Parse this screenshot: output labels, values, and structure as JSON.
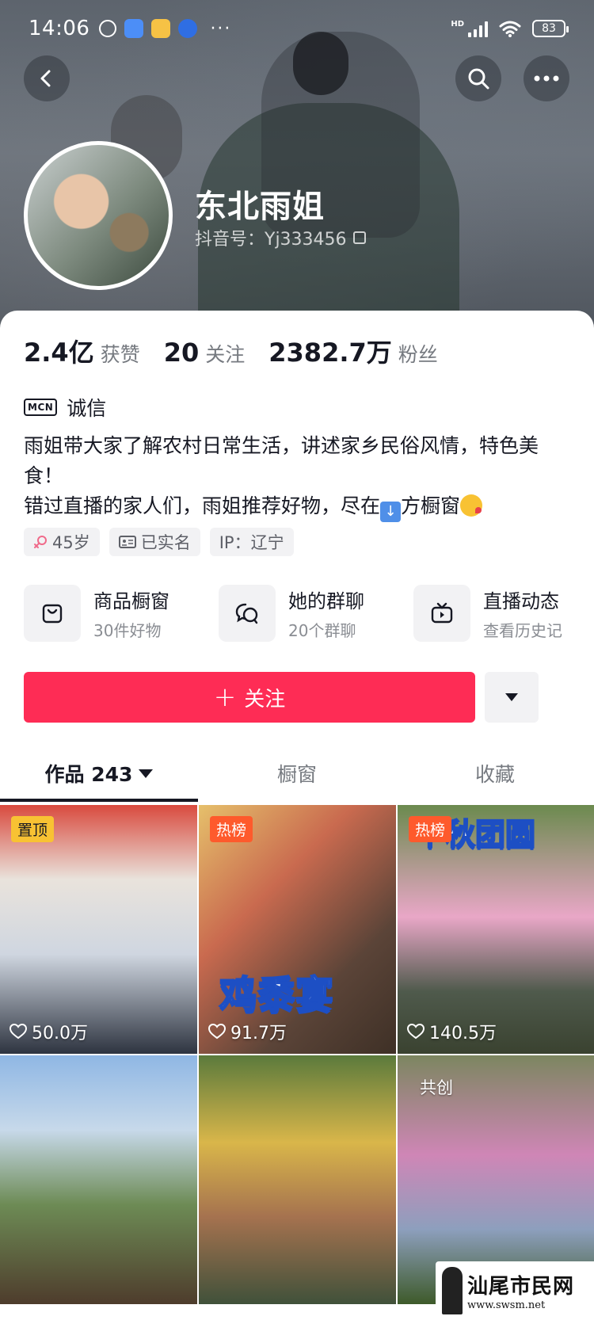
{
  "status_bar": {
    "time": "14:06",
    "network": "HD",
    "battery": "83",
    "icons": [
      "alarm-icon",
      "app-icon",
      "mail-icon",
      "browser-icon"
    ],
    "more": "···"
  },
  "header": {
    "back_icon": "back-icon",
    "search_icon": "search-icon",
    "more_icon": "more-icon"
  },
  "profile": {
    "name": "东北雨姐",
    "douyin_id": "抖音号：Yj333456"
  },
  "stats": [
    {
      "num": "2.4亿",
      "label": "获赞"
    },
    {
      "num": "20",
      "label": "关注"
    },
    {
      "num": "2382.7万",
      "label": "粉丝"
    }
  ],
  "mcn": {
    "badge": "MCN",
    "text": "诚信"
  },
  "bio": {
    "line1": "雨姐带大家了解农村日常生活，讲述家乡民俗风情，特色美食！",
    "line2_a": "错过直播的家人们，雨姐推荐好物，尽在",
    "line2_b": "方橱窗"
  },
  "tags": [
    {
      "icon": "female-icon",
      "text": "45岁"
    },
    {
      "icon": "id-card-icon",
      "text": "已实名"
    },
    {
      "icon": "",
      "text": "IP：辽宁"
    }
  ],
  "features": [
    {
      "icon": "shopping-bag-icon",
      "title": "商品橱窗",
      "sub": "30件好物"
    },
    {
      "icon": "group-chat-icon",
      "title": "她的群聊",
      "sub": "20个群聊"
    },
    {
      "icon": "tv-icon",
      "title": "直播动态",
      "sub": "查看历史记"
    }
  ],
  "follow": {
    "label": "关注",
    "plus": "+"
  },
  "tabs": [
    {
      "label": "作品 243",
      "active": true
    },
    {
      "label": "橱窗",
      "active": false
    },
    {
      "label": "收藏",
      "active": false
    }
  ],
  "videos": [
    {
      "badge": "置顶",
      "badge_type": "pin",
      "likes": "50.0万",
      "overlay": ""
    },
    {
      "badge": "热榜",
      "badge_type": "hot",
      "likes": "91.7万",
      "overlay": "鸡黍宴"
    },
    {
      "badge": "热榜",
      "badge_type": "hot",
      "likes": "140.5万",
      "overlay": "中秋团圆"
    },
    {
      "badge": "",
      "badge_type": "",
      "likes": "",
      "overlay": ""
    },
    {
      "badge": "",
      "badge_type": "",
      "likes": "",
      "overlay": ""
    },
    {
      "badge": "共创",
      "badge_type": "co",
      "likes": "",
      "overlay": ""
    }
  ],
  "watermark": {
    "text": "汕尾市民网",
    "url": "www.swsm.net"
  },
  "colors": {
    "accent": "#fe2c55",
    "hot_badge": "#fe5a2c",
    "pin_badge": "#f8c233"
  }
}
